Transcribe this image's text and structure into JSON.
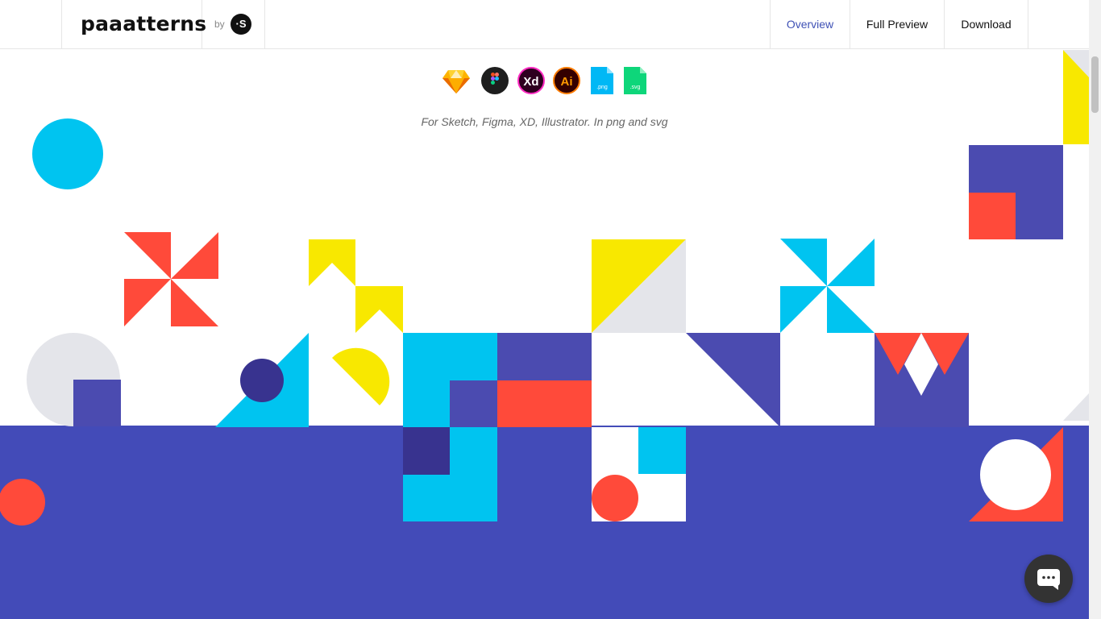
{
  "header": {
    "brand": "paaatterns",
    "by_label": "by",
    "by_logo_glyph": "·S",
    "nav": [
      {
        "label": "Overview",
        "active": true
      },
      {
        "label": "Full Preview",
        "active": false
      },
      {
        "label": "Download",
        "active": false
      }
    ]
  },
  "tools": [
    {
      "icon": "sketch-icon"
    },
    {
      "icon": "figma-icon"
    },
    {
      "icon": "xd-icon",
      "label": "Xd"
    },
    {
      "icon": "illustrator-icon",
      "label": "Ai"
    },
    {
      "icon": "png-file-icon",
      "label": ".png"
    },
    {
      "icon": "svg-file-icon",
      "label": ".svg"
    }
  ],
  "tagline": "For Sketch, Figma, XD, Illustrator. In png and svg",
  "colors": {
    "accent": "#3f51b5",
    "band": "#434bb8",
    "cyan": "#00c4f0",
    "red": "#ff4a3a",
    "yellow": "#f8e800",
    "indigo": "#4b4bb0",
    "dark_indigo": "#38338f",
    "grey": "#e4e5ea"
  }
}
